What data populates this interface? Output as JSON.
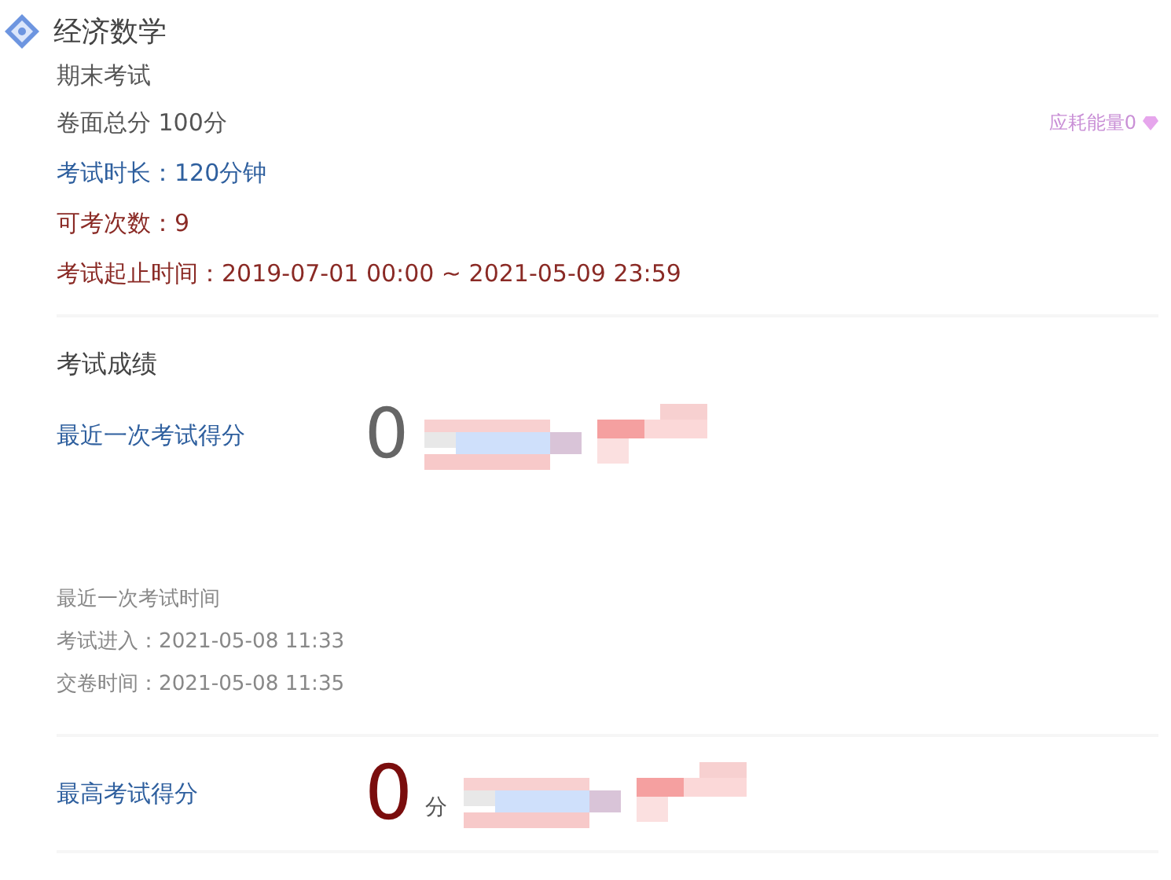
{
  "course": {
    "title": "经济数学"
  },
  "exam": {
    "name": "期末考试",
    "total": "卷面总分 100分",
    "energy": "应耗能量0",
    "duration": "考试时长：120分钟",
    "attempts": "可考次数：9",
    "period": "考试起止时间：2019-07-01 00:00 ~ 2021-05-09 23:59"
  },
  "results": {
    "heading": "考试成绩",
    "latest": {
      "label": "最近一次考试得分",
      "score": "0"
    },
    "latest_time": {
      "heading": "最近一次考试时间",
      "entered": "考试进入：2021-05-08 11:33",
      "submitted": "交卷时间：2021-05-08 11:35"
    },
    "best": {
      "label": "最高考试得分",
      "score": "0",
      "unit": "分"
    }
  }
}
